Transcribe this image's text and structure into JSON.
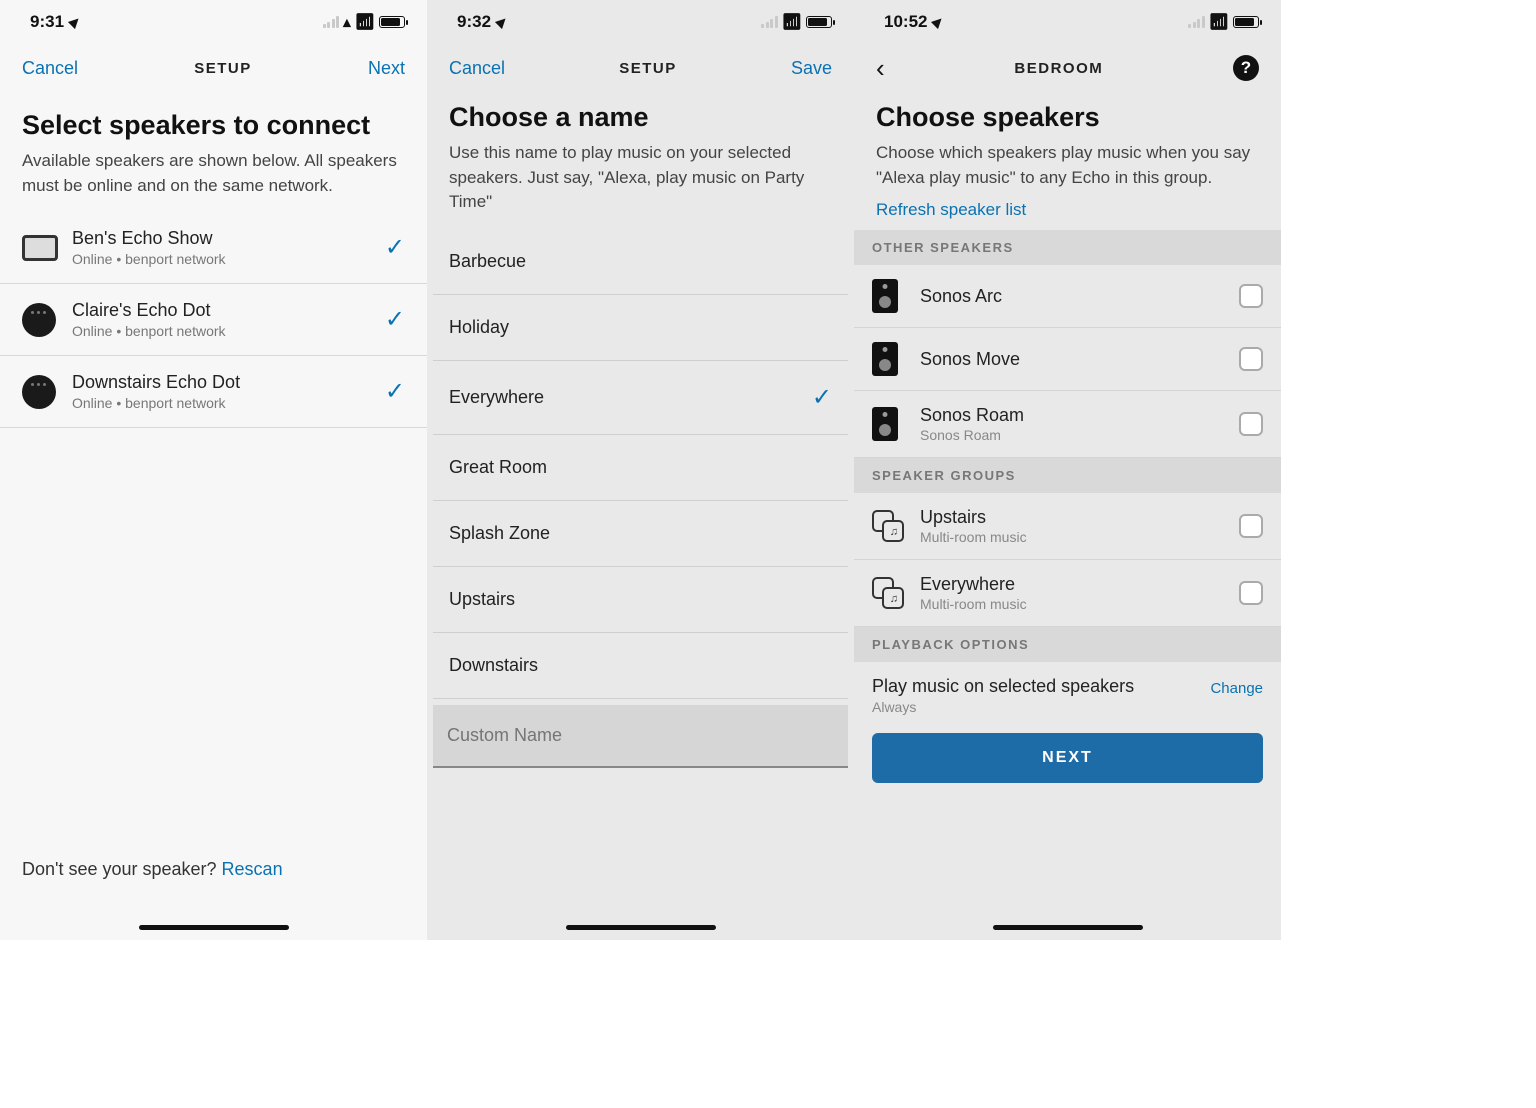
{
  "screen1": {
    "status_time": "9:31",
    "nav_left": "Cancel",
    "nav_title": "SETUP",
    "nav_right": "Next",
    "heading": "Select speakers to connect",
    "sub": "Available speakers are shown below. All speakers must be online and on the same network.",
    "speakers": [
      {
        "name": "Ben's Echo Show",
        "status": "Online • benport network",
        "icon": "tablet",
        "checked": true
      },
      {
        "name": "Claire's Echo Dot",
        "status": "Online • benport network",
        "icon": "dot",
        "checked": true
      },
      {
        "name": "Downstairs Echo Dot",
        "status": "Online • benport network",
        "icon": "dot",
        "checked": true
      }
    ],
    "footer_prompt": "Don't see your speaker?  ",
    "footer_link": "Rescan"
  },
  "screen2": {
    "status_time": "9:32",
    "nav_left": "Cancel",
    "nav_title": "SETUP",
    "nav_right": "Save",
    "heading": "Choose a name",
    "sub": "Use this name to play music on your selected speakers. Just say, \"Alexa, play music on Party Time\"",
    "names": [
      {
        "label": "Barbecue",
        "selected": false
      },
      {
        "label": "Holiday",
        "selected": false
      },
      {
        "label": "Everywhere",
        "selected": true
      },
      {
        "label": "Great Room",
        "selected": false
      },
      {
        "label": "Splash Zone",
        "selected": false
      },
      {
        "label": "Upstairs",
        "selected": false
      },
      {
        "label": "Downstairs",
        "selected": false
      }
    ],
    "custom_placeholder": "Custom Name"
  },
  "screen3": {
    "status_time": "10:52",
    "nav_title": "BEDROOM",
    "heading": "Choose speakers",
    "sub": "Choose which speakers play music when you say \"Alexa play music\" to any Echo in this group.",
    "refresh_link": "Refresh speaker list",
    "section_other": "OTHER SPEAKERS",
    "other_speakers": [
      {
        "name": "Sonos Arc",
        "sub": "",
        "checked": false
      },
      {
        "name": "Sonos Move",
        "sub": "",
        "checked": false
      },
      {
        "name": "Sonos Roam",
        "sub": "Sonos Roam",
        "checked": false
      }
    ],
    "section_groups": "SPEAKER GROUPS",
    "groups": [
      {
        "name": "Upstairs",
        "sub": "Multi-room music",
        "checked": false
      },
      {
        "name": "Everywhere",
        "sub": "Multi-room music",
        "checked": false
      }
    ],
    "section_playback": "PLAYBACK OPTIONS",
    "playback_title": "Play music on selected speakers",
    "playback_sub": "Always",
    "playback_change": "Change",
    "next_button": "NEXT"
  }
}
